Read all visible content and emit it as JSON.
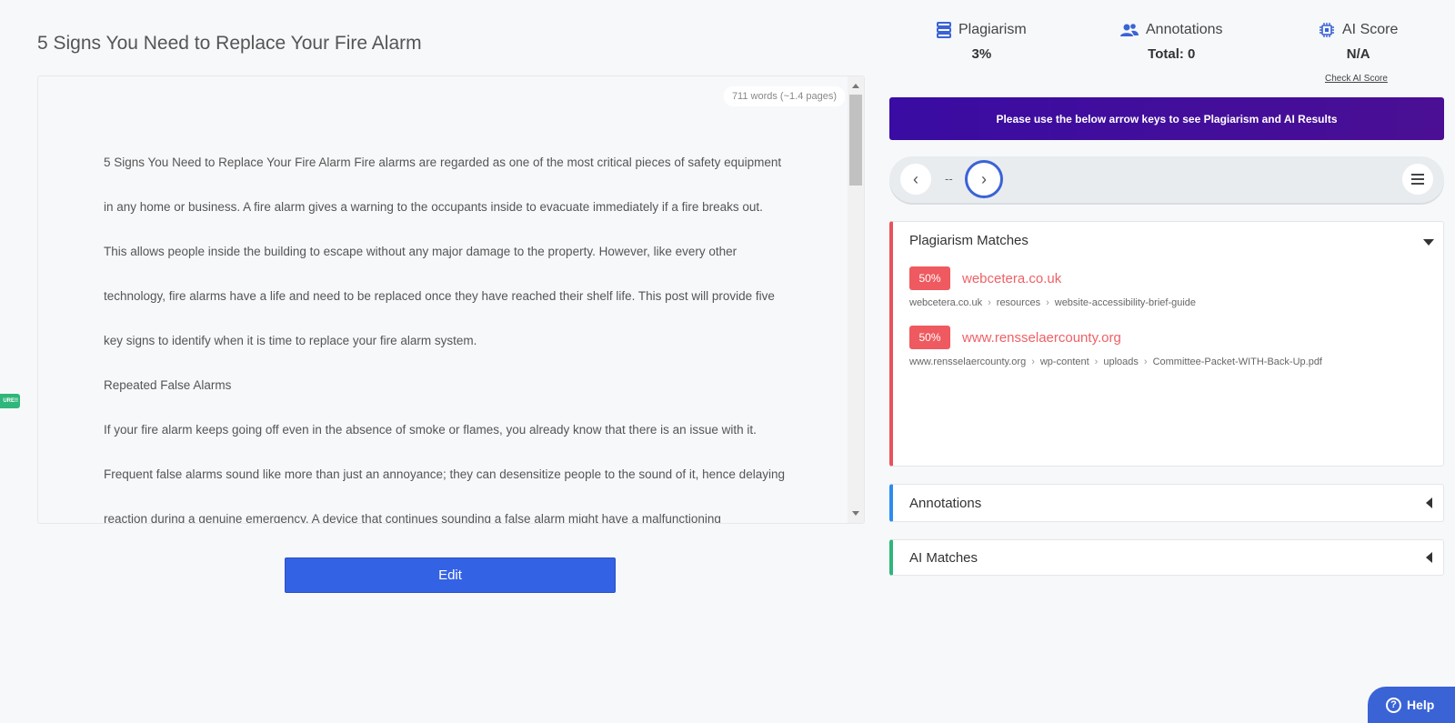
{
  "document": {
    "title": "5 Signs You Need to Replace Your Fire Alarm",
    "word_count": "711 words (~1.4 pages)",
    "paragraphs": [
      "5 Signs You Need to Replace Your Fire Alarm Fire alarms are regarded as one of the most critical pieces of safety equipment in any home or business. A fire alarm gives a warning to the occupants inside to evacuate immediately if a fire breaks out. This allows people inside the building to escape without any major damage to the property. However, like every other technology, fire alarms have a life and need to be replaced once they have reached their shelf life. This post will provide five key signs to identify when it is time to replace your fire alarm system.",
      "Repeated False Alarms",
      "If your fire alarm keeps going off even in the absence of smoke or flames, you already know that there is an issue with it. Frequent false alarms sound like more than just an annoyance; they can desensitize people to the sound of it, hence delaying reaction during a genuine emergency. A device that continues sounding a false alarm might have a malfunctioning"
    ],
    "edit_label": "Edit",
    "side_tab_label": "URE!!"
  },
  "metrics": {
    "plagiarism": {
      "label": "Plagiarism",
      "value": "3%",
      "icon": "database-icon",
      "color": "#3a63d6"
    },
    "annotations": {
      "label": "Annotations",
      "value": "Total: 0",
      "icon": "users-icon",
      "color": "#3a63d6"
    },
    "ai_score": {
      "label": "AI Score",
      "value": "N/A",
      "icon": "chip-icon",
      "color": "#3a63d6",
      "link": "Check AI Score"
    }
  },
  "banner": {
    "text": "Please use the below arrow keys to see Plagiarism and AI Results"
  },
  "navigator": {
    "counter": "--"
  },
  "panels": {
    "plagiarism_matches": {
      "title": "Plagiarism Matches",
      "matches": [
        {
          "percent": "50%",
          "site": "webcetera.co.uk",
          "crumbs": [
            "webcetera.co.uk",
            "resources",
            "website-accessibility-brief-guide"
          ]
        },
        {
          "percent": "50%",
          "site": "www.rensselaercounty.org",
          "crumbs": [
            "www.rensselaercounty.org",
            "wp-content",
            "uploads",
            "Committee-Packet-WITH-Back-Up.pdf"
          ]
        }
      ]
    },
    "annotations": {
      "title": "Annotations"
    },
    "ai_matches": {
      "title": "AI Matches"
    }
  },
  "help": {
    "label": "Help"
  }
}
